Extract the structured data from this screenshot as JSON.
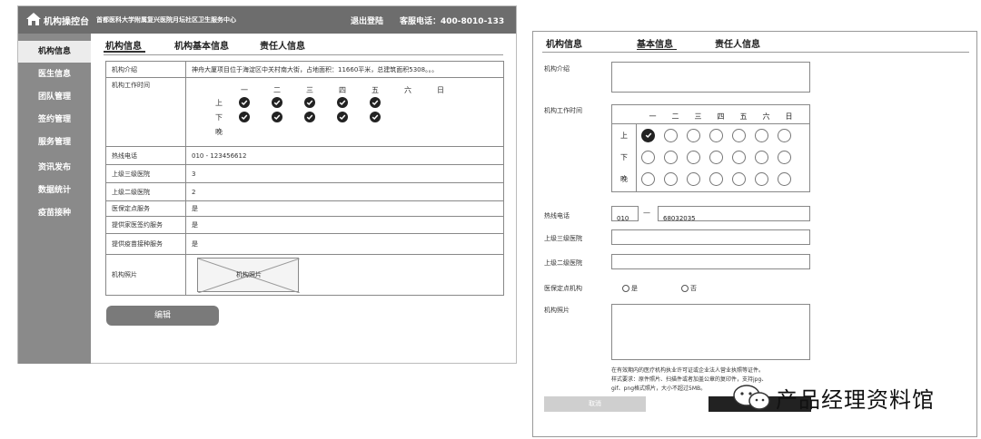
{
  "left": {
    "header": {
      "console_label": "机构操控台",
      "org_name": "首都医科大学附属复兴医院月坛社区卫生服务中心",
      "logout_label": "退出登陆",
      "service_phone": "客服电话：400-8010-133"
    },
    "sidebar": {
      "items": [
        {
          "label": "机构信息",
          "active": true
        },
        {
          "label": "医生信息"
        },
        {
          "label": "团队管理"
        },
        {
          "label": "签约管理"
        },
        {
          "label": "服务管理"
        },
        {
          "label": "资讯发布"
        },
        {
          "label": "数据统计"
        },
        {
          "label": "疫苗接种"
        }
      ]
    },
    "tabs": [
      "机构信息",
      "机构基本信息",
      "责任人信息"
    ],
    "table": {
      "intro_label": "机构介绍",
      "intro_value": "神舟大厦项目位于海淀区中关村南大街，占地面积：11660平米，总建筑面积5308。。。",
      "hours_label": "机构工作时间",
      "days": [
        "一",
        "二",
        "三",
        "四",
        "五",
        "六",
        "日"
      ],
      "slots": [
        "上",
        "下",
        "晚"
      ],
      "hours": [
        [
          1,
          1,
          1,
          1,
          1,
          0,
          0
        ],
        [
          1,
          1,
          1,
          1,
          1,
          0,
          0
        ],
        [
          0,
          0,
          0,
          0,
          0,
          0,
          0
        ]
      ],
      "rows": [
        {
          "label": "热线电话",
          "value": "010 - 123456612"
        },
        {
          "label": "上级三级医院",
          "value": "3"
        },
        {
          "label": "上级二级医院",
          "value": "2"
        },
        {
          "label": "医保定点服务",
          "value": "是"
        },
        {
          "label": "提供家医签约服务",
          "value": "是"
        },
        {
          "label": "提供疫苗接种服务",
          "value": "是"
        }
      ],
      "photo_label": "机构照片",
      "photo_placeholder": "机构照片"
    },
    "edit_button": "编辑"
  },
  "right": {
    "tabs": [
      "机构信息",
      "基本信息",
      "责任人信息"
    ],
    "form": {
      "intro_label": "机构介绍",
      "hours_label": "机构工作时间",
      "days": [
        "一",
        "二",
        "三",
        "四",
        "五",
        "六",
        "日"
      ],
      "slots": [
        "上",
        "下",
        "晚"
      ],
      "hours": [
        [
          1,
          0,
          0,
          0,
          0,
          0,
          0
        ],
        [
          0,
          0,
          0,
          0,
          0,
          0,
          0
        ],
        [
          0,
          0,
          0,
          0,
          0,
          0,
          0
        ]
      ],
      "phone_label": "热线电话",
      "phone_area": "010",
      "phone_dash": "—",
      "phone_number": "68032035",
      "tier3_label": "上级三级医院",
      "tier2_label": "上级二级医院",
      "insurance_label": "医保定点机构",
      "insurance_yes": "是",
      "insurance_no": "否",
      "photo_label": "机构照片",
      "note_line1": "在有效期内的医疗机构执业许可证或企业法人营业执照等证件。",
      "note_line2": "样式要求：原件照片、扫描件或者加盖公章的复印件，支持jpg、",
      "note_line3": "gif、png格式照片，大小不超过5MB。",
      "cancel_label": "取消"
    }
  },
  "watermark": {
    "text": "产品经理资料馆"
  }
}
